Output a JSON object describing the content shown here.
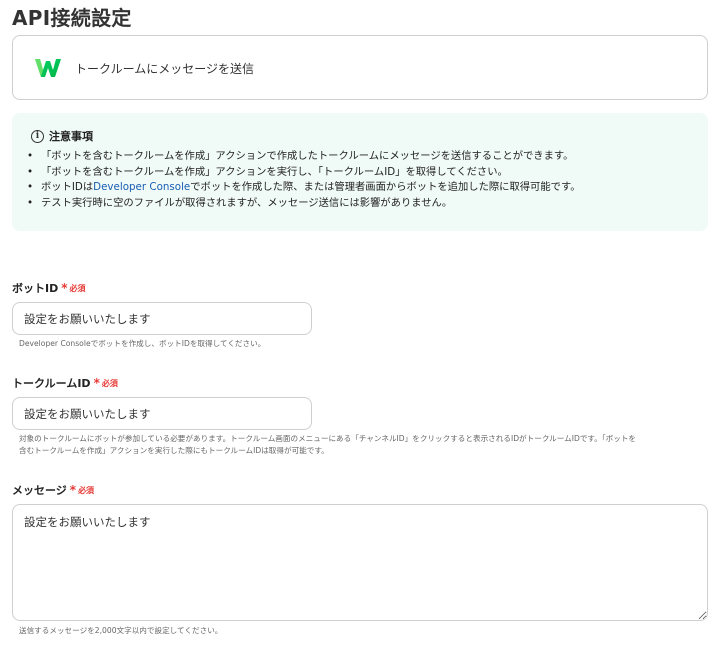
{
  "page": {
    "title": "API接続設定"
  },
  "action": {
    "label": "トークルームにメッセージを送信",
    "icon": "line-works-logo-icon",
    "brand_color": "#00c73c"
  },
  "notice": {
    "heading": "注意事項",
    "icon": "info-icon",
    "items": [
      "「ボットを含むトークルームを作成」アクションで作成したトークルームにメッセージを送信することができます。",
      "「ボットを含むトークルームを作成」アクションを実行し、「トークルームID」を取得してください。",
      "テスト実行時に空のファイルが取得されますが、メッセージ送信には影響がありません。"
    ],
    "item3": {
      "before": "ボットIDは",
      "link": "Developer Console",
      "after": "でボットを作成した際、または管理者画面からボットを追加した際に取得可能です。"
    },
    "background": "#f0faf7"
  },
  "fields": {
    "bot_id": {
      "label": "ボットID",
      "required_mark": "*",
      "required_text": "必須",
      "placeholder": "設定をお願いいたします",
      "help": "Developer Consoleでボットを作成し、ボットIDを取得してください。"
    },
    "talkroom_id": {
      "label": "トークルームID",
      "required_mark": "*",
      "required_text": "必須",
      "placeholder": "設定をお願いいたします",
      "help_line1": "対象のトークルームにボットが参加している必要があります。トークルーム画面のメニューにある「チャンネルID」をクリックすると表示されるIDがトークルームIDです。「ボットを",
      "help_line2": "含むトークルームを作成」アクションを実行した際にもトークルームIDは取得が可能です。"
    },
    "message": {
      "label": "メッセージ",
      "required_mark": "*",
      "required_text": "必須",
      "placeholder": "設定をお願いいたします",
      "help": "送信するメッセージを2,000文字以内で設定してください。"
    }
  },
  "colors": {
    "required": "#e53935",
    "link": "#1a5fb4",
    "border": "#cfcfcf"
  }
}
